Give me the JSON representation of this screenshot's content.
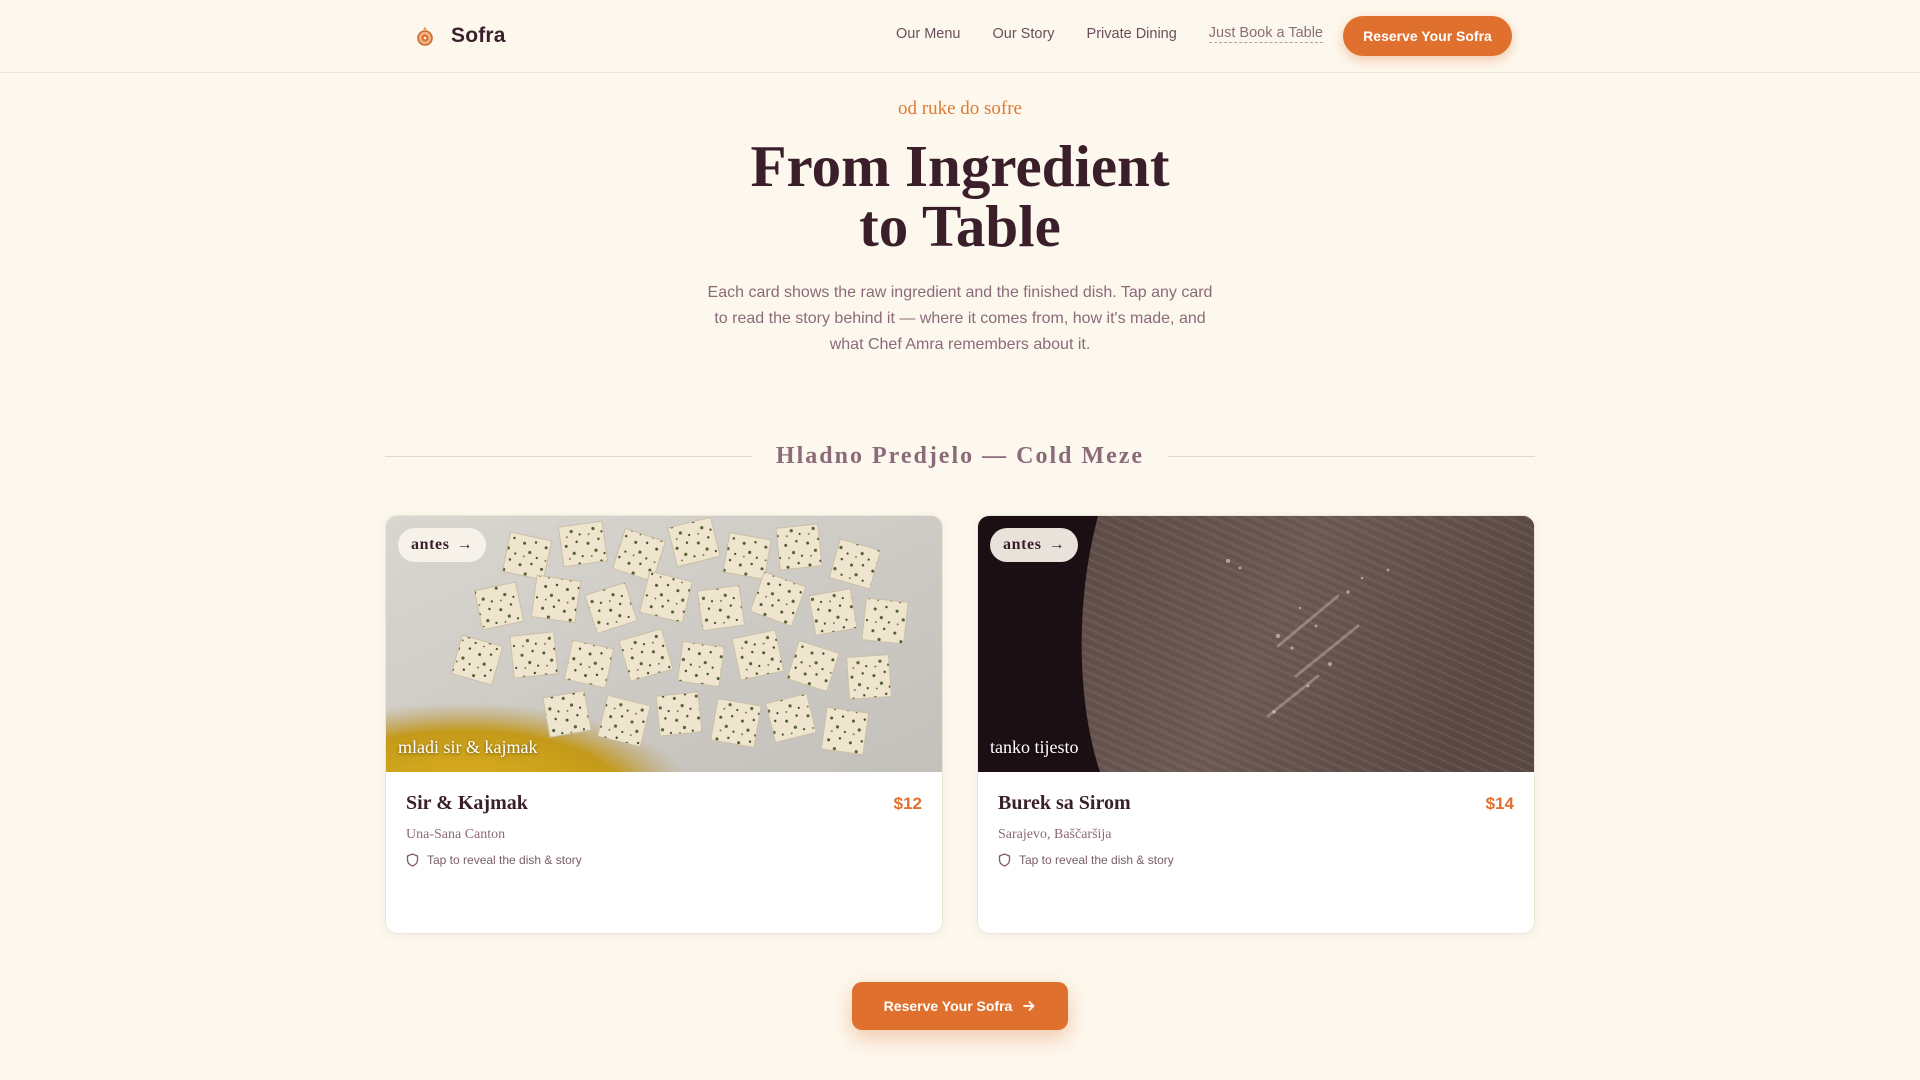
{
  "brand": {
    "name": "Sofra",
    "logo_icon": "pomegranate-icon"
  },
  "nav": {
    "links": [
      {
        "label": "Our Menu"
      },
      {
        "label": "Our Story"
      },
      {
        "label": "Private Dining"
      },
      {
        "label": "Just Book a Table"
      }
    ],
    "cta_label": "Reserve Your Sofra"
  },
  "hero": {
    "eyebrow": "od ruke do sofre",
    "title_line1": "From Ingredient",
    "title_line2": "to Table",
    "description": "Each card shows the raw ingredient and the finished dish. Tap any card to read the story behind it — where it comes from, how it's made, and what Chef Amra remembers about it."
  },
  "section": {
    "title": "Hladno Predjelo — Cold Meze"
  },
  "cards": [
    {
      "badge": "antes",
      "badge_arrow": "→",
      "image_caption": "mladi sir & kajmak",
      "name": "Sir & Kajmak",
      "price": "$12",
      "origin": "Una-Sana Canton",
      "hint": "Tap to reveal the dish & story",
      "hint_icon": "shield-icon"
    },
    {
      "badge": "antes",
      "badge_arrow": "→",
      "image_caption": "tanko tijesto",
      "name": "Burek sa Sirom",
      "price": "$14",
      "origin": "Sarajevo, Baščaršija",
      "hint": "Tap to reveal the dish & story",
      "hint_icon": "shield-icon"
    }
  ],
  "bottom_cta": {
    "label": "Reserve Your Sofra",
    "icon": "arrow-right-icon"
  },
  "colors": {
    "background": "#fdf8ee",
    "accent": "#e0702d",
    "heading": "#3a1f2b",
    "muted": "#8b6a7a"
  }
}
